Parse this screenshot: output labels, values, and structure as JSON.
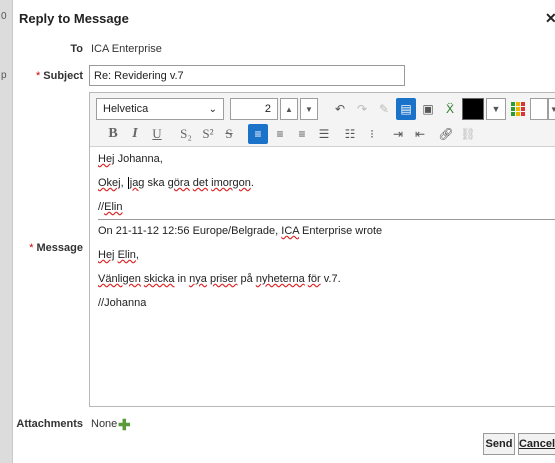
{
  "left_fragments": {
    "top": "0",
    "mid": "p"
  },
  "dialog": {
    "title": "Reply to Message",
    "close_icon": "close-icon"
  },
  "to": {
    "label": "To",
    "value": "ICA Enterprise"
  },
  "subject": {
    "label": "Subject",
    "value": "Re: Revidering v.7"
  },
  "toolbar": {
    "font_family": "Helvetica",
    "font_size": "2",
    "up_arrow": "▲",
    "down_arrow": "▼",
    "bold": "B",
    "italic": "I",
    "underline": "U",
    "subscript": "S₂",
    "superscript": "S²",
    "strikethrough": "S",
    "text_color": "#000000",
    "highlight_color": "#ffffff",
    "accent": "#1a73c9"
  },
  "message": {
    "label": "Message",
    "lines": [
      "Hej Johanna,",
      "Okej, jag ska göra det imorgon.",
      "//Elin",
      "On 21-11-12 12:56 Europe/Belgrade, ICA Enterprise wrote",
      "Hej Elin,",
      "Vänligen skicka in nya priser på nyheterna för v.7.",
      "//Johanna"
    ]
  },
  "attachments": {
    "label": "Attachments",
    "value": "None"
  },
  "buttons": {
    "send": "Send",
    "cancel": "Cancel"
  }
}
